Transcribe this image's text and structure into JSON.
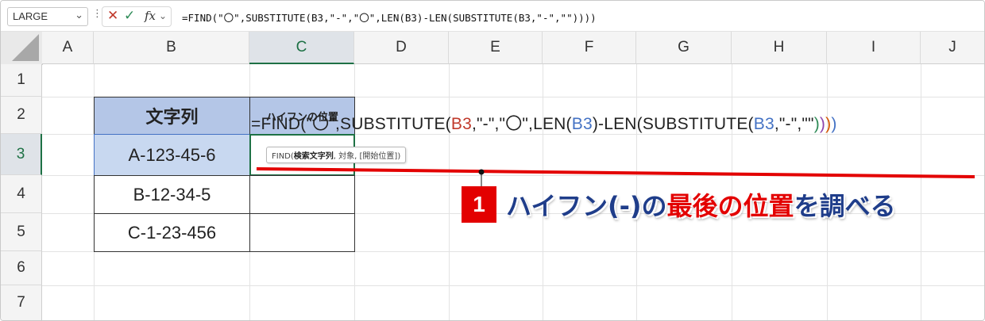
{
  "namebox": {
    "value": "LARGE"
  },
  "formula_bar": {
    "text": "=FIND(\"〇\",SUBSTITUTE(B3,\"-\",\"〇\",LEN(B3)-LEN(SUBSTITUTE(B3,\"-\",\"\"))))",
    "fx_label": "fx"
  },
  "columns": [
    "A",
    "B",
    "C",
    "D",
    "E",
    "F",
    "G",
    "H",
    "I",
    "J"
  ],
  "rows": [
    "1",
    "2",
    "3",
    "4",
    "5",
    "6",
    "7"
  ],
  "table": {
    "header_b": "文字列",
    "header_c": "ハイフンの位置",
    "values": [
      "A-123-45-6",
      "B-12-34-5",
      "C-1-23-456"
    ]
  },
  "cell_formula": {
    "p1": "=FIND(\"〇\",SUBSTITUTE(",
    "p2": "B3",
    "p3": ",\"-\",\"〇\",LEN(",
    "p4": "B3",
    "p5": ")-LEN(SUBSTITUTE(",
    "p6": "B3",
    "p7": ",\"-\",\"\"",
    "p8": ")",
    "p9": ")",
    "p10": ")",
    "p11": ")"
  },
  "tooltip": {
    "fn": "FIND(",
    "arg1": "検索文字列",
    "rest": ", 対象, [開始位置])"
  },
  "callout": {
    "number": "1",
    "text_a": "ハイフン(-)の",
    "text_b": "最後の位置",
    "text_c": "を調べる"
  },
  "colors": {
    "accent_red": "#e30000",
    "navy": "#1f3d8a",
    "header_fill": "#b4c6e7",
    "excel_green": "#1e7145"
  },
  "icons": [
    "chevron-down-icon",
    "kebab-icon",
    "cancel-icon",
    "check-icon",
    "fx-icon"
  ]
}
